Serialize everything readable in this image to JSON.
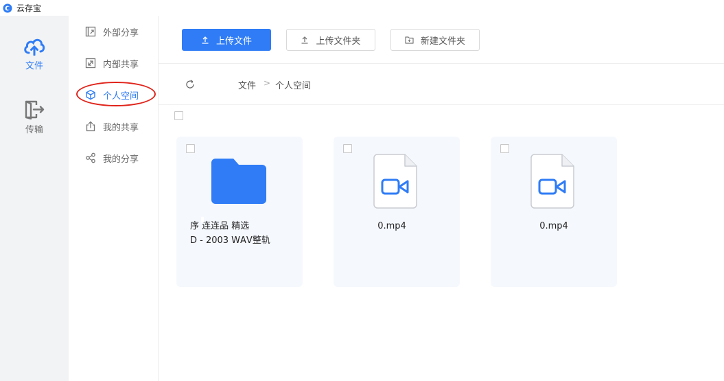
{
  "window": {
    "title": "云存宝"
  },
  "leftbar": {
    "items": [
      {
        "label": "文件",
        "icon": "cloud-icon",
        "active": true
      },
      {
        "label": "传输",
        "icon": "transfer-icon",
        "active": false
      }
    ]
  },
  "subnav": {
    "items": [
      {
        "label": "外部分享",
        "icon": "external-share-icon"
      },
      {
        "label": "内部共享",
        "icon": "internal-share-icon"
      },
      {
        "label": "个人空间",
        "icon": "cube-icon",
        "active": true
      },
      {
        "label": "我的共享",
        "icon": "upload-share-icon"
      },
      {
        "label": "我的分享",
        "icon": "share-nodes-icon"
      }
    ]
  },
  "toolbar": {
    "upload_file": "上传文件",
    "upload_folder": "上传文件夹",
    "new_folder": "新建文件夹"
  },
  "breadcrumb": {
    "root": "文件",
    "separator": ">",
    "current": "个人空间"
  },
  "files": [
    {
      "type": "folder",
      "name_line1": "序 连连品      精选",
      "name_line2": "D - 2003     WАV整轨"
    },
    {
      "type": "video",
      "name": "0.mp4"
    },
    {
      "type": "video",
      "name": "0.mp4"
    }
  ],
  "colors": {
    "accent": "#2f7cf6",
    "annotation": "#e0241b",
    "card_bg": "#f5f8fd"
  }
}
